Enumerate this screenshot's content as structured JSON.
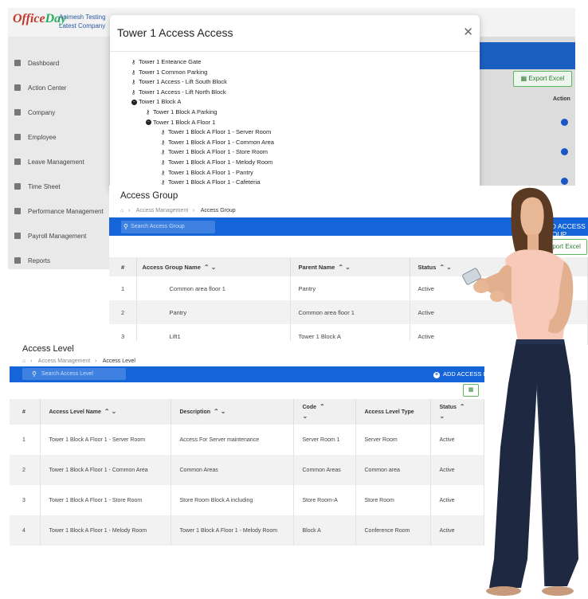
{
  "back_app": {
    "logo": {
      "main": "Office",
      "accent": "Day"
    },
    "company_line1": "Animesh Testing",
    "company_line2": "Latest Company",
    "sidebar": [
      {
        "label": "Dashboard",
        "icon": "dashboard-icon"
      },
      {
        "label": "Action Center",
        "icon": "users-icon"
      },
      {
        "label": "Company",
        "icon": "building-icon"
      },
      {
        "label": "Employee",
        "icon": "user-icon"
      },
      {
        "label": "Leave Management",
        "icon": "users-icon"
      },
      {
        "label": "Time Sheet",
        "icon": "calendar-icon"
      },
      {
        "label": "Performance Management",
        "icon": "chart-icon"
      },
      {
        "label": "Payroll Management",
        "icon": "money-icon"
      },
      {
        "label": "Reports",
        "icon": "bar-chart-icon"
      }
    ],
    "export_label": "Export Excel",
    "action_header": "Action"
  },
  "modal": {
    "title": "Tower 1 Access Access",
    "tree": [
      {
        "label": "Tower 1 Enteance Gate",
        "level": 0,
        "kind": "key"
      },
      {
        "label": "Tower 1 Common Parking",
        "level": 0,
        "kind": "key"
      },
      {
        "label": "Tower 1 Access - Lift South Block",
        "level": 0,
        "kind": "key"
      },
      {
        "label": "Tower 1 Access - Lift North Block",
        "level": 0,
        "kind": "key"
      },
      {
        "label": "Tower 1 Block A",
        "level": 0,
        "kind": "node"
      },
      {
        "label": "Tower 1 Block A Parking",
        "level": 1,
        "kind": "key"
      },
      {
        "label": "Tower 1 Block A Floor 1",
        "level": 1,
        "kind": "node"
      },
      {
        "label": "Tower 1 Block A Floor 1 - Server Room",
        "level": 2,
        "kind": "key"
      },
      {
        "label": "Tower 1 Block A Floor 1 - Common Area",
        "level": 2,
        "kind": "key"
      },
      {
        "label": "Tower 1 Block A Floor 1 - Store Room",
        "level": 2,
        "kind": "key"
      },
      {
        "label": "Tower 1 Block A Floor 1 - Melody Room",
        "level": 2,
        "kind": "key"
      },
      {
        "label": "Tower 1 Block A Floor 1 - Pantry",
        "level": 2,
        "kind": "key"
      },
      {
        "label": "Tower 1 Block A Floor 1 - Cafeteria",
        "level": 2,
        "kind": "key"
      }
    ]
  },
  "access_group": {
    "title": "Access Group",
    "breadcrumb": {
      "parent": "Access Management",
      "current": "Access Group"
    },
    "search_placeholder": "Search Access Group",
    "add_label": "ADD ACCESS GROUP",
    "export_label": "Export Excel",
    "columns": [
      "#",
      "Access Group Name",
      "Parent Name",
      "Status"
    ],
    "rows": [
      {
        "num": "1",
        "name": "Common area floor 1",
        "parent": "Pantry",
        "status": "Active"
      },
      {
        "num": "2",
        "name": "Pantry",
        "parent": "Common area floor 1",
        "status": "Active"
      },
      {
        "num": "3",
        "name": "Lift1",
        "parent": "Tower 1 Block A",
        "status": "Active"
      }
    ]
  },
  "access_level": {
    "title": "Access Level",
    "breadcrumb": {
      "parent": "Access Management",
      "current": "Access Level"
    },
    "search_placeholder": "Search Access Level",
    "add_label": "ADD ACCESS LEVEL",
    "columns": [
      "#",
      "Access Level Name",
      "Description",
      "Code",
      "Access Level Type",
      "Status"
    ],
    "rows": [
      {
        "num": "1",
        "name": "Tower 1 Block A Floor 1 - Server Room",
        "description": "Access For Server maintenance",
        "code": "Server Room 1",
        "type": "Server Room",
        "status": "Active"
      },
      {
        "num": "2",
        "name": "Tower 1 Block A Floor 1 - Common Area",
        "description": "Common Areas",
        "code": "Common Areas",
        "type": "Common area",
        "status": "Active"
      },
      {
        "num": "3",
        "name": "Tower 1 Block A Floor 1 - Store Room",
        "description": "Store Room Block A including",
        "code": "Store Room-A",
        "type": "Store Room",
        "status": "Active"
      },
      {
        "num": "4",
        "name": "Tower 1 Block A Floor 1 - Melody Room",
        "description": "Tower 1 Block A Floor 1 - Melody Room",
        "code": "Block A",
        "type": "Conference Room",
        "status": "Active"
      }
    ]
  },
  "colors": {
    "primary_blue": "#1565d8",
    "export_green": "#2e7d32",
    "delete_red": "#e53935"
  }
}
